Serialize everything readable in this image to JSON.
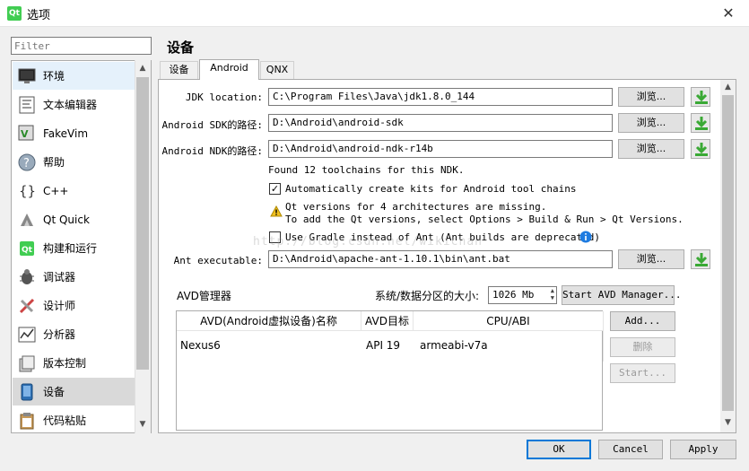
{
  "window": {
    "title": "选项",
    "app_icon_text": "Qt",
    "close_glyph": "✕"
  },
  "filter": {
    "placeholder": "Filter"
  },
  "categories": [
    {
      "label": "环境",
      "icon": "monitor-icon"
    },
    {
      "label": "文本编辑器",
      "icon": "text-editor-icon"
    },
    {
      "label": "FakeVim",
      "icon": "fakevim-icon"
    },
    {
      "label": "帮助",
      "icon": "help-icon"
    },
    {
      "label": "C++",
      "icon": "cpp-braces-icon"
    },
    {
      "label": "Qt Quick",
      "icon": "qt-quick-icon"
    },
    {
      "label": "构建和运行",
      "icon": "build-run-icon"
    },
    {
      "label": "调试器",
      "icon": "debugger-icon"
    },
    {
      "label": "设计师",
      "icon": "designer-icon"
    },
    {
      "label": "分析器",
      "icon": "analyzer-icon"
    },
    {
      "label": "版本控制",
      "icon": "version-control-icon"
    },
    {
      "label": "设备",
      "icon": "device-icon"
    },
    {
      "label": "代码粘贴",
      "icon": "code-paste-icon"
    }
  ],
  "selected_category": "设备",
  "page_title": "设备",
  "tabs": [
    {
      "label": "设备"
    },
    {
      "label": "Android"
    },
    {
      "label": "QNX"
    }
  ],
  "active_tab": "Android",
  "android": {
    "jdk_label": "JDK location:",
    "jdk_value": "C:\\Program Files\\Java\\jdk1.8.0_144",
    "sdk_label": "Android SDK的路径:",
    "sdk_value": "D:\\Android\\android-sdk",
    "ndk_label": "Android NDK的路径:",
    "ndk_value": "D:\\Android\\android-ndk-r14b",
    "browse_label": "浏览...",
    "toolchains_text": "Found 12 toolchains for this NDK.",
    "auto_kits_label": "Automatically create kits for Android tool chains",
    "auto_kits_checked": true,
    "warning_line1": "Qt versions for 4 architectures are missing.",
    "warning_line2": "To add the Qt versions, select Options > Build & Run > Qt Versions.",
    "gradle_label": "Use Gradle instead of Ant (Ant builds are deprecated)",
    "gradle_checked": false,
    "ant_label": "Ant executable:",
    "ant_value": "D:\\Android\\apache-ant-1.10.1\\bin\\ant.bat"
  },
  "avd": {
    "section_label": "AVD管理器",
    "partition_label": "系统/数据分区的大小:",
    "partition_value": "1026 Mb",
    "start_manager_label": "Start AVD Manager...",
    "columns": [
      "AVD(Android虚拟设备)名称",
      "AVD目标",
      "CPU/ABI"
    ],
    "rows": [
      {
        "name": "Nexus6",
        "target": "API 19",
        "abi": "armeabi-v7a"
      }
    ],
    "add_label": "Add...",
    "delete_label": "删除",
    "start_label": "Start..."
  },
  "footer": {
    "ok_label": "OK",
    "cancel_label": "Cancel",
    "apply_label": "Apply"
  },
  "watermark": "http://blog.csdn.net/wikichan",
  "colors": {
    "accent": "#0078d7",
    "download_green": "#3aa935",
    "selected_bg": "#d9d9d9"
  }
}
